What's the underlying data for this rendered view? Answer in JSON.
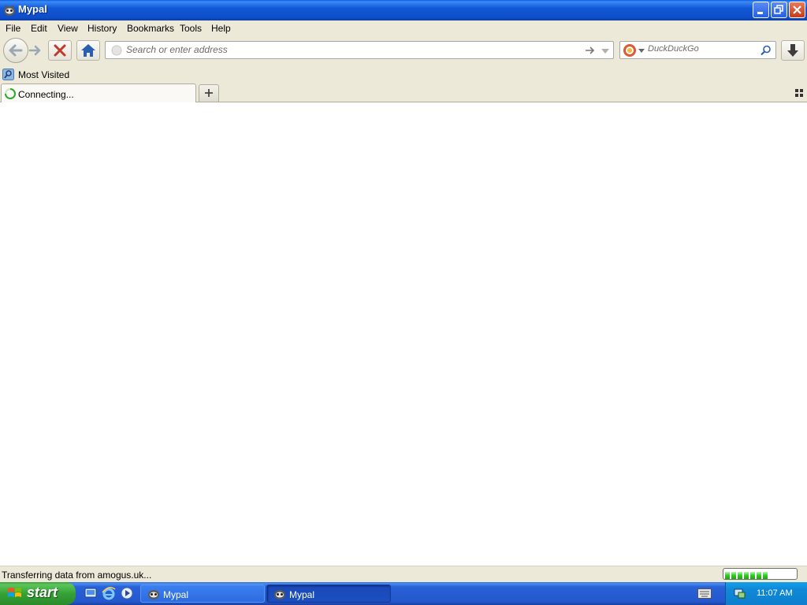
{
  "window": {
    "title": "Mypal"
  },
  "menu": [
    "File",
    "Edit",
    "View",
    "History",
    "Bookmarks",
    "Tools",
    "Help"
  ],
  "navbar": {
    "url_placeholder": "Search or enter address",
    "url_value": "",
    "search_placeholder": "DuckDuckGo"
  },
  "bookmarks": {
    "items": [
      {
        "label": "Most Visited"
      }
    ]
  },
  "tabs": [
    {
      "label": "Connecting...",
      "loading": true
    }
  ],
  "status": {
    "text": "Transferring data from amogus.uk...",
    "progress_fraction": 0.7
  },
  "taskbar": {
    "start_label": "start",
    "tasks": [
      {
        "label": "Mypal"
      },
      {
        "label": "Mypal"
      }
    ],
    "clock": "11:07 AM"
  },
  "colors": {
    "titlebar": "#0f4dc8",
    "taskbar": "#2457cc",
    "start": "#36a236",
    "tray": "#0f8ad8"
  }
}
